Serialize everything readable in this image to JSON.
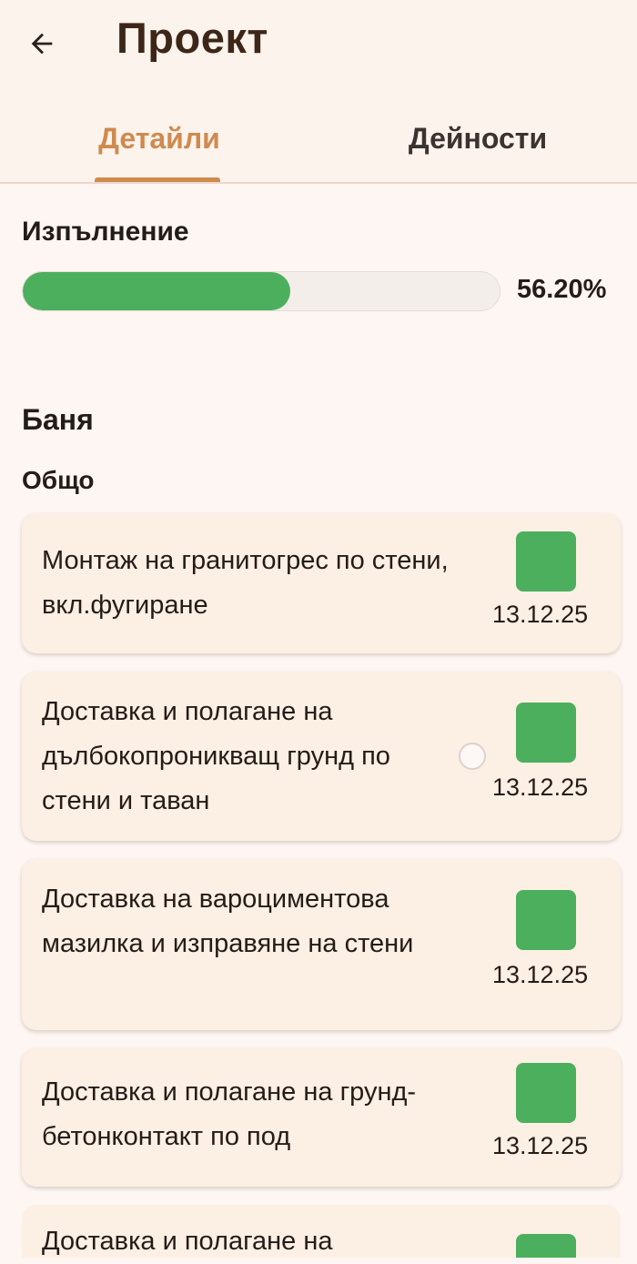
{
  "header": {
    "title": "Проект",
    "back_icon": "arrow-left-icon"
  },
  "tabs": [
    {
      "label": "Детайли",
      "active": true
    },
    {
      "label": "Дейности",
      "active": false
    }
  ],
  "progress": {
    "label": "Изпълнение",
    "value_text": "56.20%",
    "fraction": 0.562
  },
  "section": {
    "title": "Баня",
    "group_title": "Общо"
  },
  "tasks": [
    {
      "text": "Монтаж на гранитогрес по стени, вкл.фугиране",
      "date": "13.12.25",
      "done": true
    },
    {
      "text": "Доставка и полагане на дълбокопроникващ грунд по стени и таван",
      "date": "13.12.25",
      "done": true
    },
    {
      "text": "Доставка на вароциментова мазилка и изправяне на стени",
      "date": "13.12.25",
      "done": true
    },
    {
      "text": "Доставка и полагане на грунд-бетонконтакт по под",
      "date": "13.12.25",
      "done": true
    },
    {
      "text": "Доставка и полагане на",
      "date": "",
      "done": true
    }
  ],
  "colors": {
    "accent": "#cf8a4e",
    "progress": "#4caf5d",
    "card_background": "#fcefe4",
    "page_background": "#fdf6f2",
    "title": "#3d2618"
  }
}
